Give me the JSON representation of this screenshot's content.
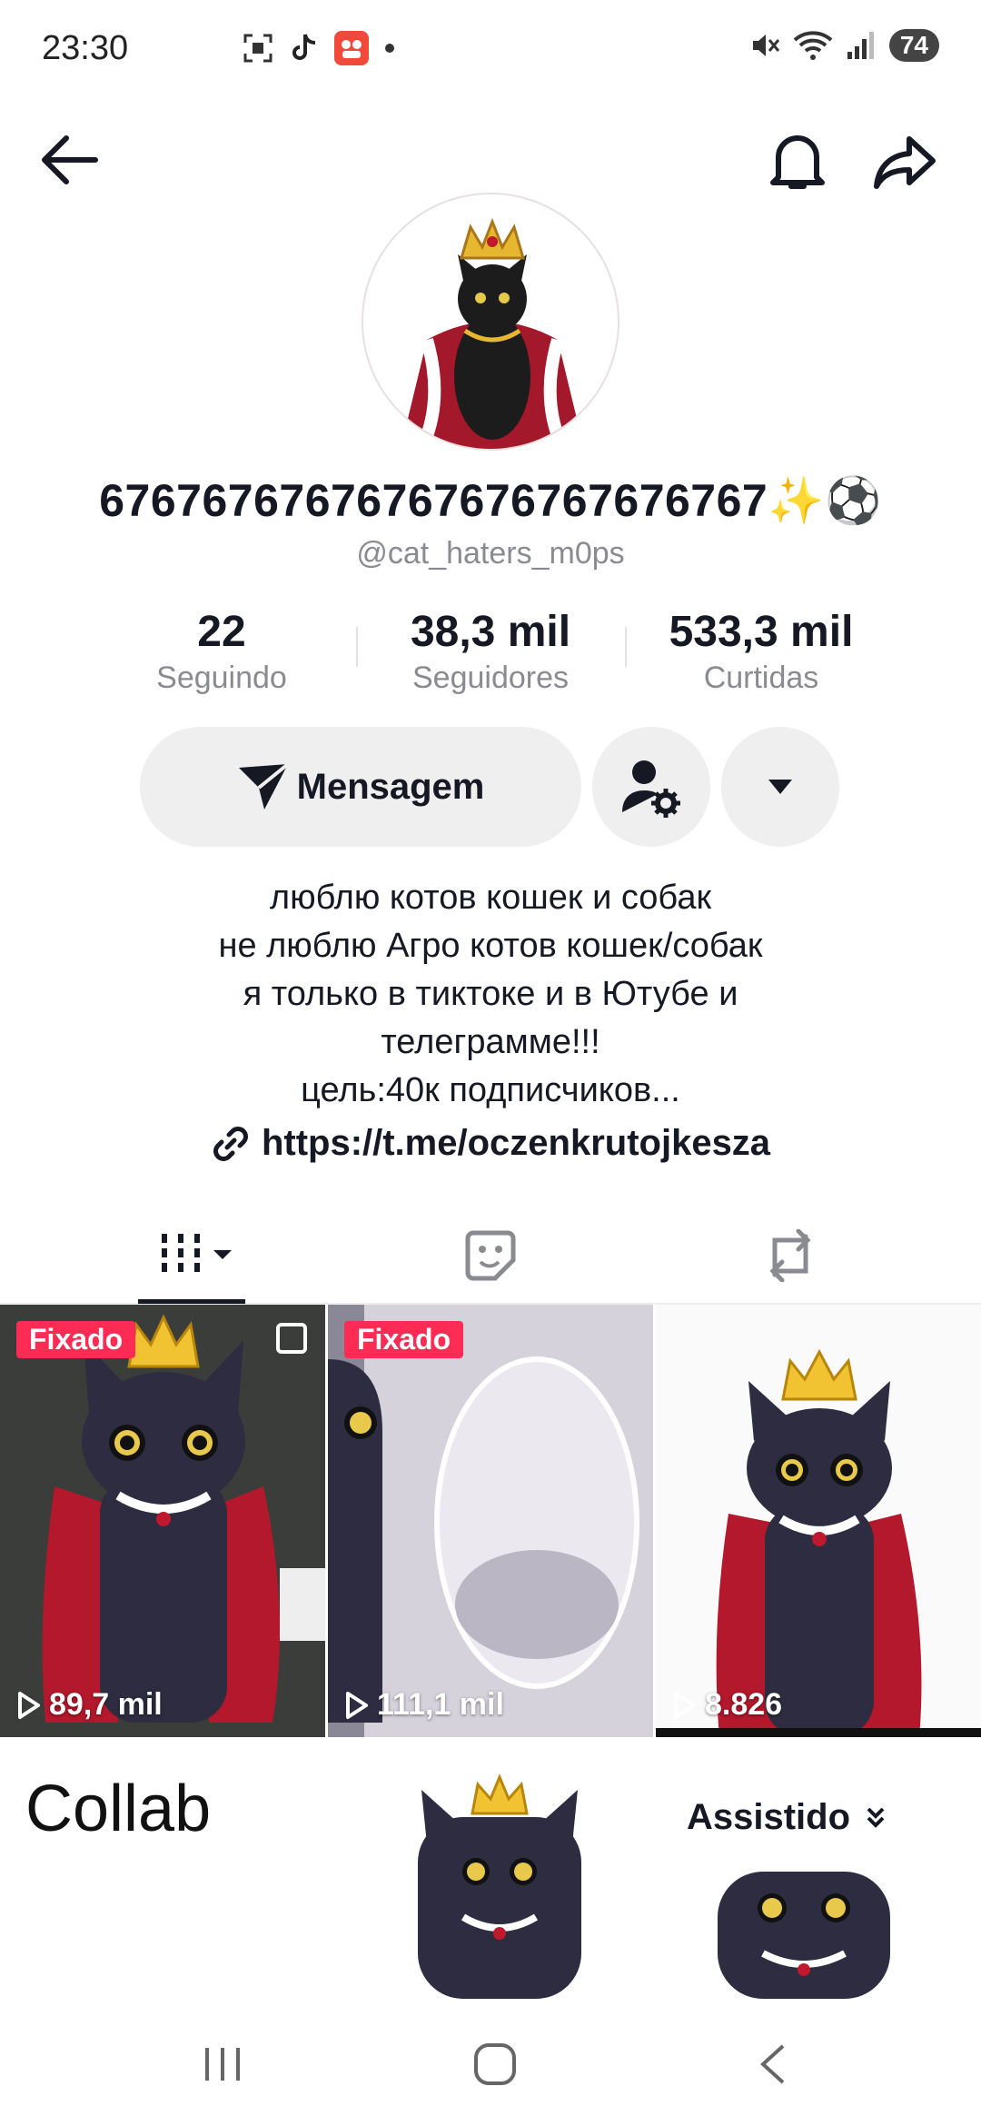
{
  "status": {
    "time": "23:30",
    "battery": "74"
  },
  "profile": {
    "display_name": "67676767676767676767676767✨⚽",
    "username": "@cat_haters_m0ps"
  },
  "stats": [
    {
      "value": "22",
      "label": "Seguindo"
    },
    {
      "value": "38,3 mil",
      "label": "Seguidores"
    },
    {
      "value": "533,3 mil",
      "label": "Curtidas"
    }
  ],
  "actions": {
    "message_label": "Mensagem"
  },
  "bio": {
    "lines": [
      "люблю котов кошек и собак",
      "не люблю Агро котов кошек/собак",
      "я только в тиктоке и в Ютубе и",
      "телеграмме!!!",
      "цель:40к подписчиков..."
    ],
    "link": "https://t.me/oczenkrutojkesza"
  },
  "tabs": [
    "videos-icon",
    "favorites-icon",
    "reposts-icon"
  ],
  "videos": [
    {
      "badge": "Fixado",
      "views": "89,7 mil"
    },
    {
      "badge": "Fixado",
      "views": "111,1 mil"
    },
    {
      "badge": "",
      "views": "8.826"
    }
  ],
  "row2": {
    "collab_label": "Collab",
    "watched_label": "Assistido"
  },
  "colors": {
    "accent": "#fe2c55",
    "button_bg": "#efefef"
  }
}
